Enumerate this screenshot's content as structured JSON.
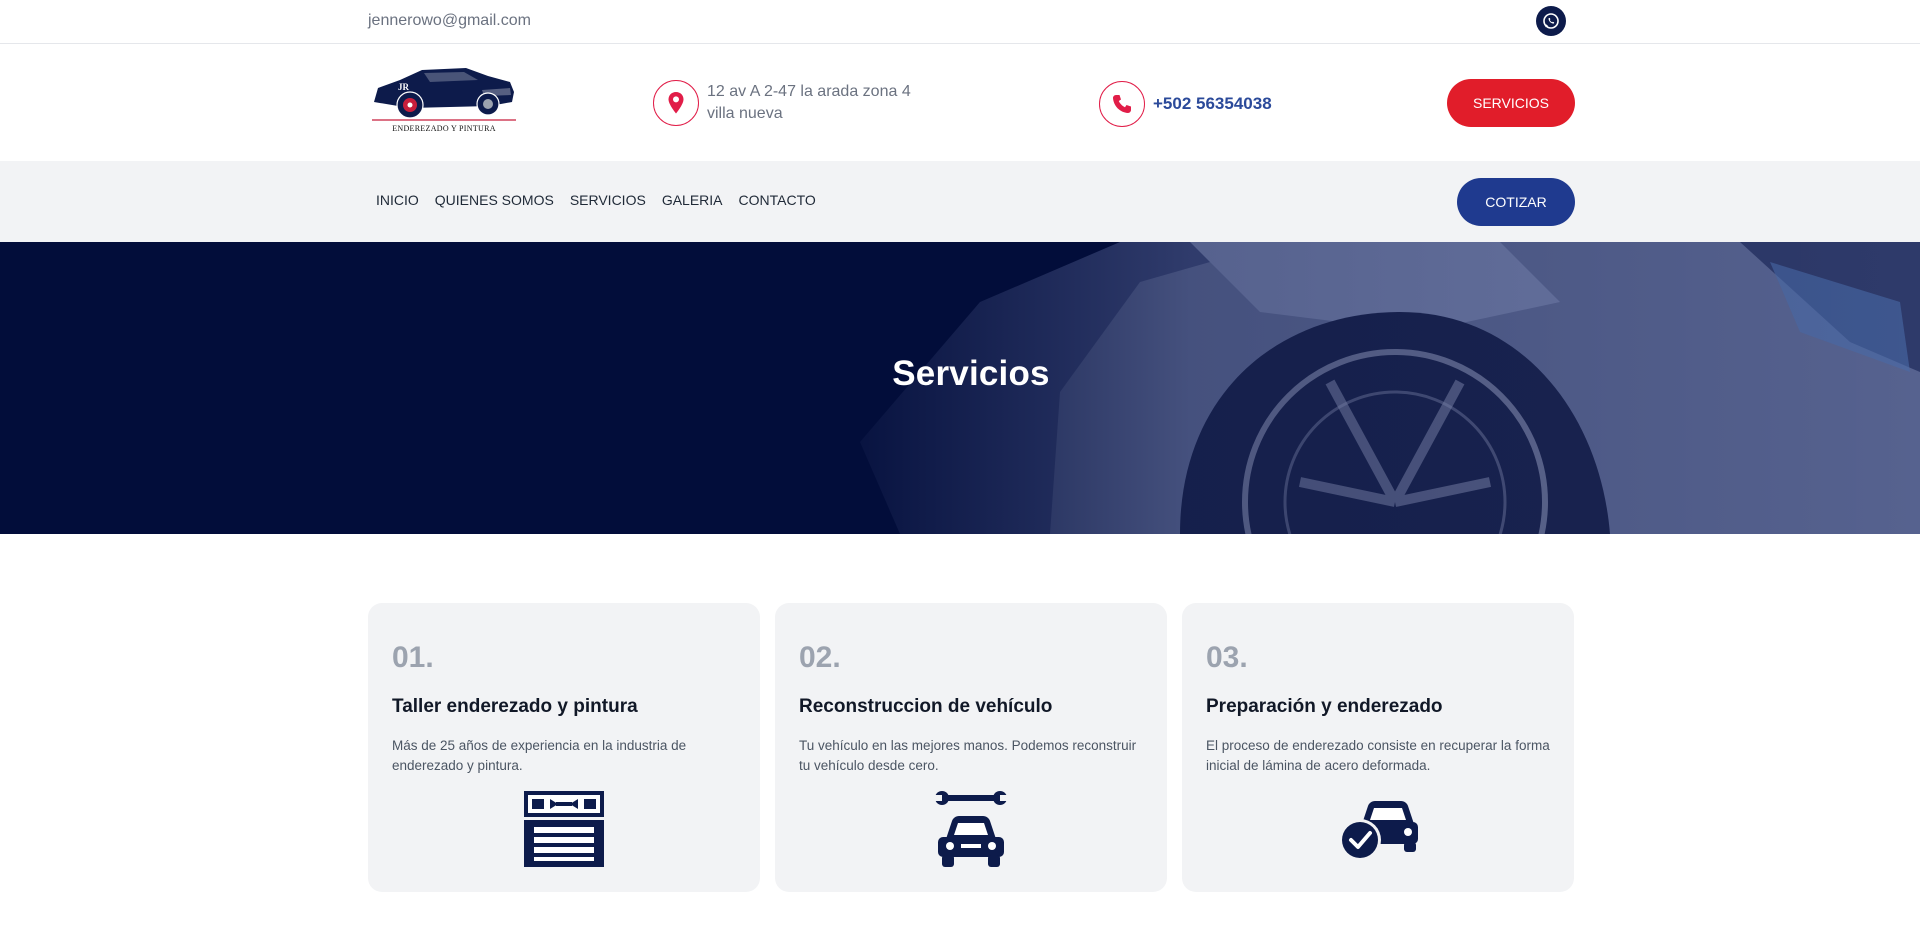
{
  "topbar": {
    "email": "jennerowo@gmail.com",
    "social_icon": "whatsapp-icon"
  },
  "header": {
    "logo_text": "Enderezado y Pintura",
    "address_line1": "12 av A 2-47 la arada zona 4",
    "address_line2": "villa nueva",
    "phone": "+502 56354038",
    "cta_label": "SERVICIOS"
  },
  "nav": {
    "items": [
      "INICIO",
      "QUIENES SOMOS",
      "SERVICIOS",
      "GALERIA",
      "CONTACTO"
    ],
    "cta_label": "COTIZAR"
  },
  "hero": {
    "title": "Servicios"
  },
  "cards": [
    {
      "num": "01.",
      "title": "Taller enderezado y pintura",
      "desc": "Más de 25 años de experiencia en la industria de enderezado y pintura.",
      "icon": "garage-tools-icon"
    },
    {
      "num": "02.",
      "title": "Reconstruccion de vehículo",
      "desc": "Tu vehículo en las mejores manos. Podemos reconstruir tu vehículo desde cero.",
      "icon": "car-wrench-icon"
    },
    {
      "num": "03.",
      "title": "Preparación y enderezado",
      "desc": "El proceso de enderezado consiste en recuperar la forma inicial de lámina de acero deformada.",
      "icon": "car-check-icon"
    }
  ],
  "colors": {
    "navy": "#020d3a",
    "accent_red": "#e11d2a",
    "cta_blue": "#1f3a8f",
    "icon_navy": "#0d1b4b"
  }
}
